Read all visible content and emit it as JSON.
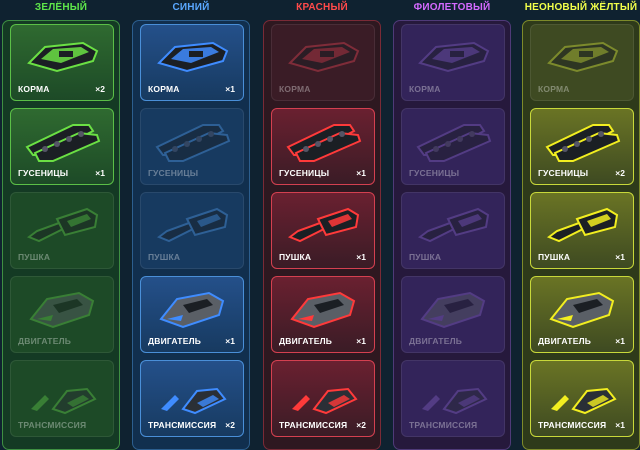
{
  "parts": {
    "hull": "КОРМА",
    "tracks": "ГУСЕНИЦЫ",
    "gun": "ПУШКА",
    "engine": "ДВИГАТЕЛЬ",
    "transmission": "ТРАНСМИССИЯ"
  },
  "columns": [
    {
      "title": "ЗЕЛЁНЫЙ",
      "title_color": "#5ee64a",
      "panel_bg": "#143a24",
      "panel_border": "#3e8f42",
      "card_bg": "#2f6a30",
      "card_off_bg": "#1d4a27",
      "card_border": "#5bbf47",
      "part_color": "#6be044",
      "cards": [
        {
          "count": "×2",
          "owned": true
        },
        {
          "count": "×1",
          "owned": true
        },
        {
          "count": "",
          "owned": false
        },
        {
          "count": "",
          "owned": false
        },
        {
          "count": "",
          "owned": false
        }
      ]
    },
    {
      "title": "СИНИЙ",
      "title_color": "#5aa8ff",
      "panel_bg": "#112f4e",
      "panel_border": "#2c5e8e",
      "card_bg": "#24508a",
      "card_off_bg": "#173a60",
      "card_border": "#4a8fd8",
      "part_color": "#3f8cff",
      "cards": [
        {
          "count": "×1",
          "owned": true
        },
        {
          "count": "",
          "owned": false
        },
        {
          "count": "",
          "owned": false
        },
        {
          "count": "×1",
          "owned": true
        },
        {
          "count": "×2",
          "owned": true
        }
      ]
    },
    {
      "title": "КРАСНЫЙ",
      "title_color": "#ff4a4a",
      "panel_bg": "#2e1820",
      "panel_border": "#7a2a36",
      "card_bg": "#6a2030",
      "card_off_bg": "#3a1c26",
      "card_border": "#d44050",
      "part_color": "#ff3a3a",
      "cards": [
        {
          "count": "",
          "owned": false
        },
        {
          "count": "×1",
          "owned": true
        },
        {
          "count": "×1",
          "owned": true
        },
        {
          "count": "×1",
          "owned": true
        },
        {
          "count": "×2",
          "owned": true
        }
      ]
    },
    {
      "title": "ФИОЛЕТОВЫЙ",
      "title_color": "#d46aff",
      "panel_bg": "#26193c",
      "panel_border": "#4f3a78",
      "card_bg": "#43306e",
      "card_off_bg": "#33245a",
      "card_border": "#7a5ab8",
      "part_color": "#a55cff",
      "cards": [
        {
          "count": "",
          "owned": false
        },
        {
          "count": "",
          "owned": false
        },
        {
          "count": "",
          "owned": false
        },
        {
          "count": "",
          "owned": false
        },
        {
          "count": "",
          "owned": false
        }
      ]
    },
    {
      "title": "НЕОНОВЫЙ ЖЁЛТЫЙ",
      "title_color": "#f2ff4a",
      "panel_bg": "#2e3a1a",
      "panel_border": "#7d8a2a",
      "card_bg": "#6a7424",
      "card_off_bg": "#3e4a22",
      "card_border": "#c8d83a",
      "part_color": "#f2ee20",
      "cards": [
        {
          "count": "",
          "owned": false
        },
        {
          "count": "×2",
          "owned": true
        },
        {
          "count": "×1",
          "owned": true
        },
        {
          "count": "×1",
          "owned": true
        },
        {
          "count": "×1",
          "owned": true
        }
      ]
    }
  ]
}
